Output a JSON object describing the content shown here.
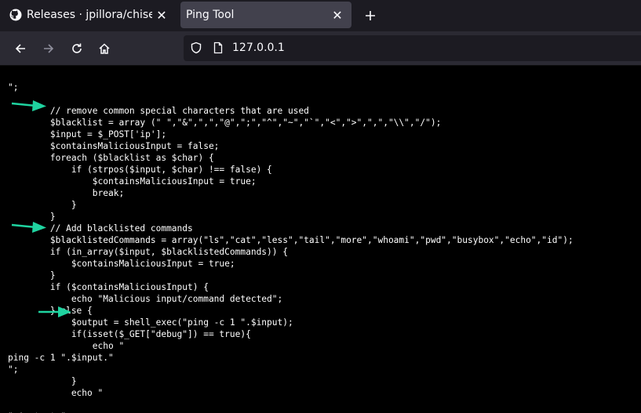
{
  "tabs": [
    {
      "title": "Releases · jpillora/chisel",
      "icon": "github-icon",
      "active": false
    },
    {
      "title": "Ping Tool",
      "icon": "",
      "active": true
    }
  ],
  "address_bar": {
    "url": "127.0.0.1"
  },
  "code": "\";\n\n        // remove common special characters that are used\n        $blacklist = array (\" \",\"&\",\",\",\"@\",\";\",\"^\",\"~\",\"`\",\"<\",\">\",\",\",\"\\\\\",\"/\");\n        $input = $_POST['ip'];\n        $containsMaliciousInput = false;\n        foreach ($blacklist as $char) {\n            if (strpos($input, $char) !== false) {\n                $containsMaliciousInput = true;\n                break;\n            }\n        }\n        // Add blacklisted commands\n        $blacklistedCommands = array(\"ls\",\"cat\",\"less\",\"tail\",\"more\",\"whoami\",\"pwd\",\"busybox\",\"echo\",\"id\");\n        if (in_array($input, $blacklistedCommands)) {\n            $containsMaliciousInput = true;\n        }\n        if ($containsMaliciousInput) {\n            echo \"Malicious input/command detected\";\n        } else {\n            $output = shell_exec(\"ping -c 1 \".$input);\n            if(isset($_GET[\"debug\"]) == true){\n                echo \"\nping -c 1 \".$input.\"\n\";\n            }\n            echo \"\n\n\".$output.\"",
  "colors": {
    "arrow": "#1fd3a0",
    "tab_bar": "#1c1b22",
    "nav_bar": "#2b2a33",
    "active_tab": "#42414d"
  }
}
